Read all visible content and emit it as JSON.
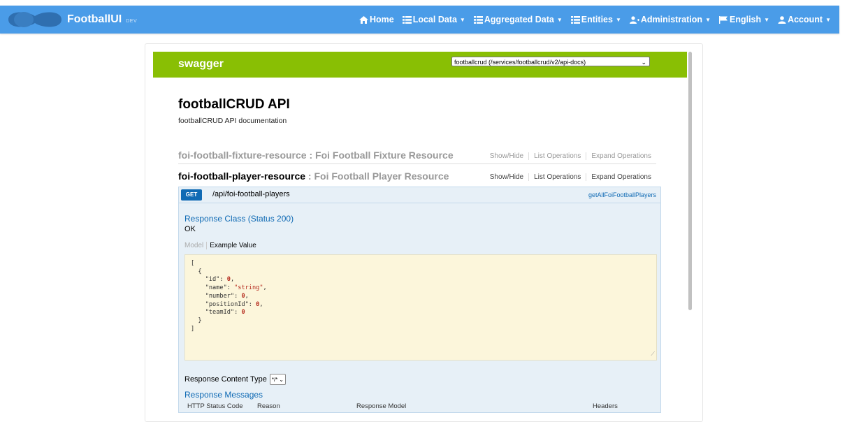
{
  "navbar": {
    "brand": "FootballUI",
    "env": "DEV",
    "links": [
      {
        "label": "Home",
        "icon": "home-icon"
      },
      {
        "label": "Local Data",
        "icon": "list-icon"
      },
      {
        "label": "Aggregated Data",
        "icon": "list-icon"
      },
      {
        "label": "Entities",
        "icon": "list-icon"
      },
      {
        "label": "Administration",
        "icon": "users-cog-icon"
      },
      {
        "label": "English",
        "icon": "flag-icon"
      },
      {
        "label": "Account",
        "icon": "user-icon"
      }
    ]
  },
  "swagger": {
    "logo": "swagger",
    "selected_spec": "footballcrud (/services/footballcrud/v2/api-docs)",
    "api_title": "footballCRUD API",
    "api_description": "footballCRUD API documentation"
  },
  "resources": [
    {
      "path": "foi-football-fixture-resource",
      "separator": " : ",
      "desc": "Foi Football Fixture Resource",
      "ops": [
        "Show/Hide",
        "List Operations",
        "Expand Operations"
      ]
    },
    {
      "path": "foi-football-player-resource",
      "separator": " : ",
      "desc": "Foi Football Player Resource",
      "ops": [
        "Show/Hide",
        "List Operations",
        "Expand Operations"
      ]
    }
  ],
  "operation": {
    "method": "GET",
    "path": "/api/foi-football-players",
    "nickname": "getAllFoiFootballPlayers",
    "response_class": "Response Class (Status 200)",
    "response_status": "OK",
    "tab_model": "Model",
    "tab_example": "Example Value",
    "example_fields": [
      {
        "key": "\"id\"",
        "value": "0",
        "kind": "num"
      },
      {
        "key": "\"name\"",
        "value": "\"string\"",
        "kind": "str"
      },
      {
        "key": "\"number\"",
        "value": "0",
        "kind": "num"
      },
      {
        "key": "\"positionId\"",
        "value": "0",
        "kind": "num"
      },
      {
        "key": "\"teamId\"",
        "value": "0",
        "kind": "num"
      }
    ],
    "response_content_type_label": "Response Content Type",
    "response_content_type_value": "*/*",
    "response_messages_title": "Response Messages",
    "response_messages_columns": [
      "HTTP Status Code",
      "Reason",
      "Response Model",
      "Headers"
    ]
  },
  "colors": {
    "navbar": "#4a9ce8",
    "swagger_green": "#89bf04",
    "get_blue": "#0f6ab4",
    "op_bg": "#e7f0f7",
    "code_bg": "#fcf6db"
  }
}
